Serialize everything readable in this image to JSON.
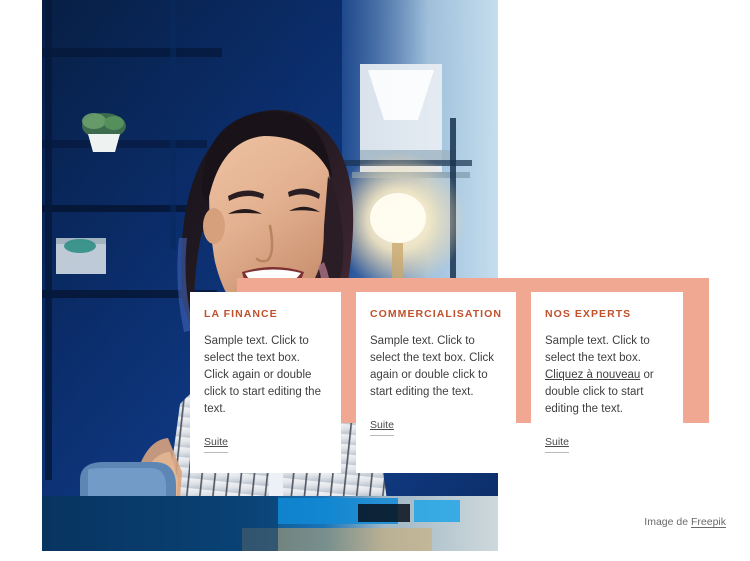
{
  "page": {
    "background_color": "#ffffff",
    "accent_color": "#f0a892",
    "title_color": "#c0512c",
    "body_text_color": "#3f3f41"
  },
  "hero_image": {
    "alt": "Smiling young woman with long dark hair in a white pinstripe shirt, sitting in a blue-lit office at night with shelves, a potted plant and a warm desk lamp behind her",
    "photo_credit_prefix": "Image de ",
    "photo_credit_link": "Freepik"
  },
  "cards": [
    {
      "title": "LA FINANCE",
      "body_parts": [
        {
          "type": "text",
          "value": "Sample text. Click to select the text box. Click again or double click to start editing the text."
        }
      ],
      "more_label": "Suite"
    },
    {
      "title": "COMMERCIALISATION",
      "body_parts": [
        {
          "type": "text",
          "value": "Sample text. Click to select the text box. Click again or double click to start editing the text."
        }
      ],
      "more_label": "Suite"
    },
    {
      "title": "NOS EXPERTS",
      "body_parts": [
        {
          "type": "text",
          "value": "Sample text. Click to select the text box. "
        },
        {
          "type": "link",
          "value": "Cliquez à nouveau"
        },
        {
          "type": "text",
          "value": " or double click to start editing the text."
        }
      ],
      "more_label": "Suite"
    }
  ]
}
